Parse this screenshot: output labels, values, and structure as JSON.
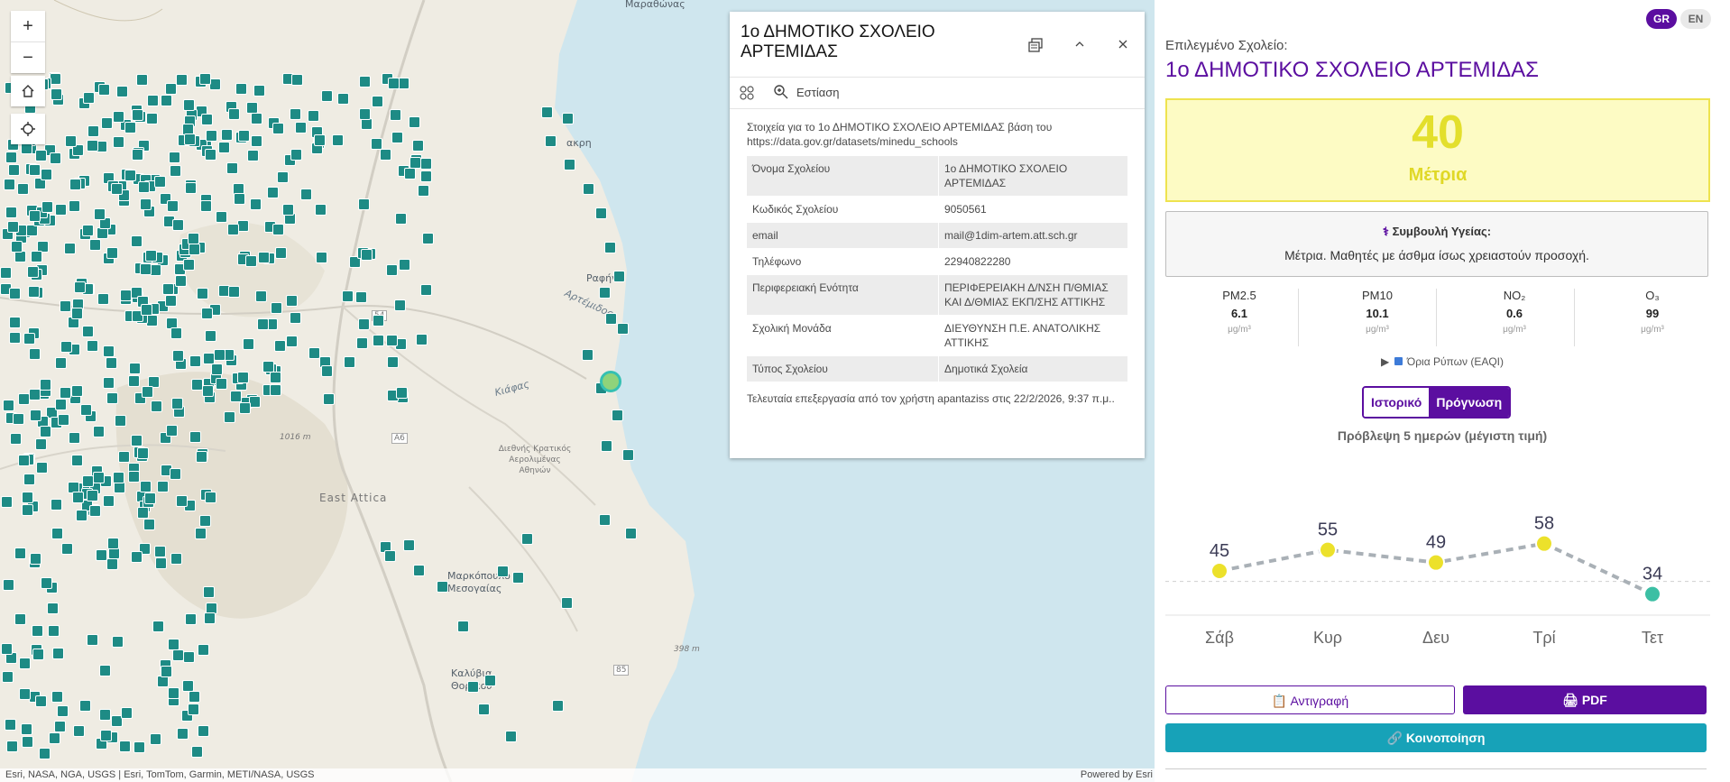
{
  "map": {
    "labels": {
      "marathonas": "Μαραθώνας",
      "nea_makri": "ακρη",
      "rafina": "Ραφήνα",
      "artemida_bay": "Αρτέμιδος",
      "kiafas": "Κιάφας",
      "athens_airport": "Διεθνής Κρατικός Αερολιμένας Αθηνών",
      "east_attica": "East Attica",
      "markopoulo": "Μαρκόπουλο Μεσογαίας",
      "road_54": "54",
      "road_a6": "Α6",
      "road_85": "85",
      "elev_1016": "1016 m",
      "elev_398": "398 m",
      "kalyvia": "Καλύβια Θορικού"
    },
    "controls": {
      "zoom_in": "+",
      "zoom_out": "−"
    },
    "attribution_left": "Esri, NASA, NGA, USGS | Esri, TomTom, Garmin, METI/NASA, USGS",
    "attribution_right": "Powered by Esri"
  },
  "popup": {
    "title": "1ο ΔΗΜΟΤΙΚΟ ΣΧΟΛΕΙΟ ΑΡΤΕΜΙΔΑΣ",
    "focus_label": "Εστίαση",
    "intro": "Στοιχεία για το 1ο ΔΗΜΟΤΙΚΟ ΣΧΟΛΕΙΟ ΑΡΤΕΜΙΔΑΣ βάση του https://data.gov.gr/datasets/minedu_schools",
    "rows": [
      {
        "key": "Όνομα Σχολείου",
        "value": "1ο ΔΗΜΟΤΙΚΟ ΣΧΟΛΕΙΟ ΑΡΤΕΜΙΔΑΣ"
      },
      {
        "key": "Κωδικός Σχολείου",
        "value": "9050561"
      },
      {
        "key": "email",
        "value": "mail@1dim-artem.att.sch.gr"
      },
      {
        "key": "Τηλέφωνο",
        "value": "22940822280"
      },
      {
        "key": "Περιφερειακή Ενότητα",
        "value": "ΠΕΡΙΦΕΡΕΙΑΚΗ Δ/ΝΣΗ Π/ΘΜΙΑΣ ΚΑΙ Δ/ΘΜΙΑΣ ΕΚΠ/ΣΗΣ ΑΤΤΙΚΗΣ"
      },
      {
        "key": "Σχολική Μονάδα",
        "value": "ΔΙΕΥΘΥΝΣΗ Π.Ε. ΑΝΑΤΟΛΙΚΗΣ ΑΤΤΙΚΗΣ"
      },
      {
        "key": "Τύπος Σχολείου",
        "value": "Δημοτικά Σχολεία"
      }
    ],
    "footnote": "Τελευταία επεξεργασία από τον χρήστη apantaziss στις 22/2/2026, 9:37 π.μ.."
  },
  "panel": {
    "lang_gr": "GR",
    "lang_en": "EN",
    "selected_label": "Επιλεγμένο Σχολείο:",
    "school_name": "1ο ΔΗΜΟΤΙΚΟ ΣΧΟΛΕΙΟ ΑΡΤΕΜΙΔΑΣ",
    "aqi_value": "40",
    "aqi_category": "Μέτρια",
    "advice_title": "Συμβουλή Υγείας:",
    "advice_text": "Μέτρια. Μαθητές με άσθμα ίσως χρειαστούν προσοχή.",
    "pollutants": [
      {
        "name": "PM2.5",
        "value": "6.1",
        "unit": "μg/m³"
      },
      {
        "name": "PM10",
        "value": "10.1",
        "unit": "μg/m³"
      },
      {
        "name": "NO₂",
        "value": "0.6",
        "unit": "μg/m³"
      },
      {
        "name": "O₃",
        "value": "99",
        "unit": "μg/m³"
      }
    ],
    "eaqi_label": "Όρια Ρύπων (EAQI)",
    "toggle_history": "Ιστορικό",
    "toggle_forecast": "Πρόγνωση",
    "forecast_title": "Πρόβλεψη 5 ημερών (μέγιστη τιμή)",
    "copy_label": "Αντιγραφή",
    "pdf_label": "PDF",
    "share_label": "Κοινοποίηση",
    "colors": {
      "brand": "#5b0ea0",
      "share": "#17a2b8",
      "moderate": "#ece12b",
      "good": "#3cbfa4"
    }
  },
  "chart_data": {
    "type": "line",
    "categories": [
      "Σάβ",
      "Κυρ",
      "Δευ",
      "Τρί",
      "Τετ"
    ],
    "values": [
      45,
      55,
      49,
      58,
      34
    ],
    "point_colors": [
      "#ece12b",
      "#ece12b",
      "#ece12b",
      "#ece12b",
      "#3cbfa4"
    ],
    "threshold": 40,
    "title": "",
    "xlabel": "",
    "ylabel": ""
  }
}
